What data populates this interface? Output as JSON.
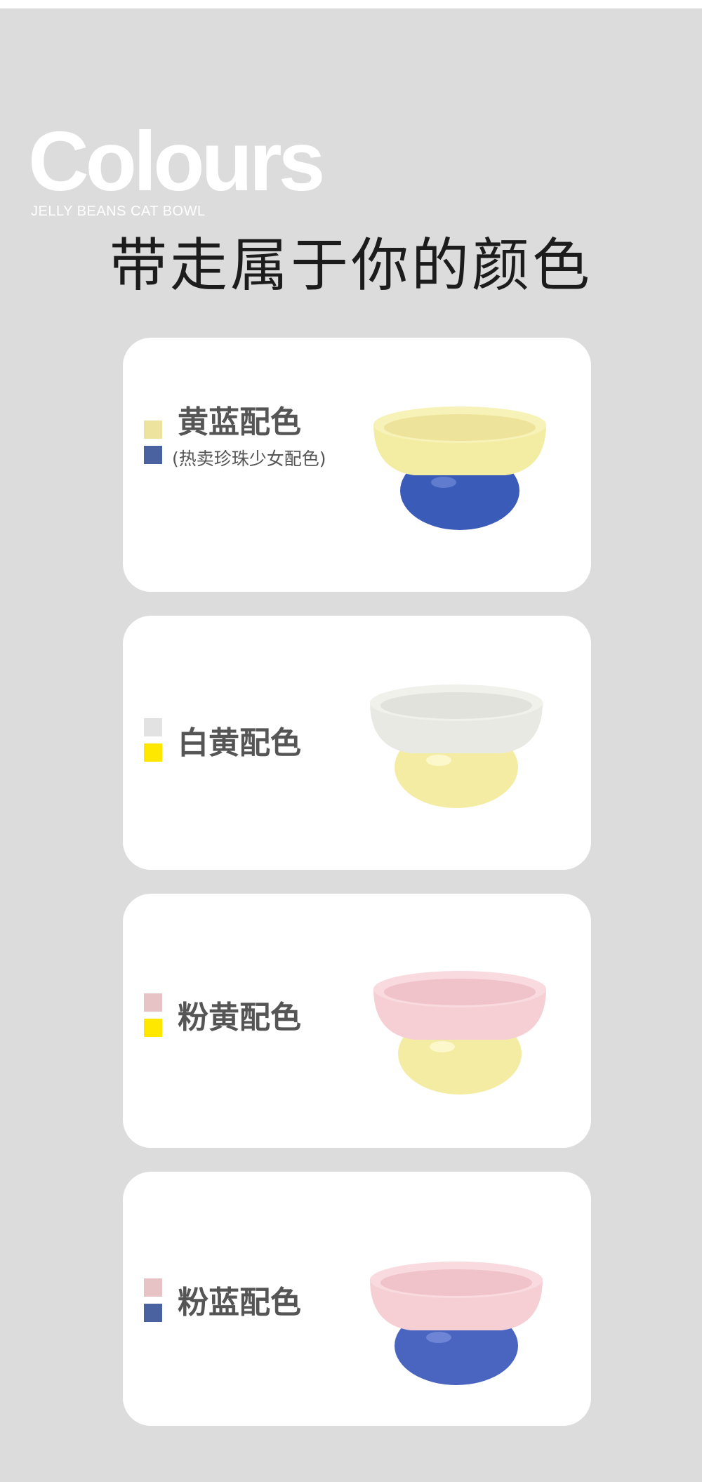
{
  "hero": {
    "title": "Colours",
    "subtitle": "JELLY BEANS CAT BOWL"
  },
  "heading": "带走属于你的颜色",
  "cards": [
    {
      "label": "黄蓝配色",
      "note": "(热卖珍珠少女配色)",
      "swatches": [
        "#ede39e",
        "#4a62a0"
      ],
      "bowl_top": "#f3eda4",
      "bowl_base": "#3a5cb8"
    },
    {
      "label": "白黄配色",
      "swatches": [
        "#e2e2e2",
        "#ffe800"
      ],
      "bowl_top": "#e9e9e4",
      "bowl_base": "#f5eca3"
    },
    {
      "label": "粉黄配色",
      "swatches": [
        "#e7c3c6",
        "#ffe800"
      ],
      "bowl_top": "#f5cfd4",
      "bowl_base": "#f5eca3"
    },
    {
      "label": "粉蓝配色",
      "swatches": [
        "#e7c3c6",
        "#4a62a0"
      ],
      "bowl_top": "#f5cfd4",
      "bowl_base": "#4a65c0"
    }
  ]
}
